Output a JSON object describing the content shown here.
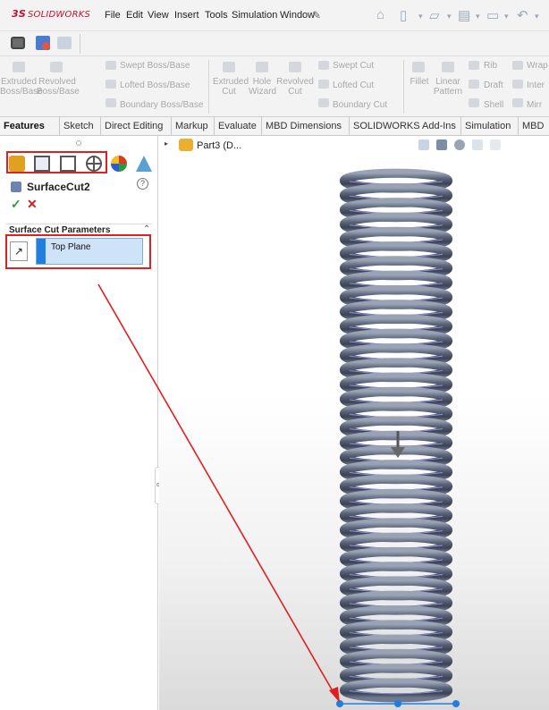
{
  "app": {
    "brand_ds": "3S",
    "brand_name": "SOLIDWORKS",
    "menu": [
      "File",
      "Edit",
      "View",
      "Insert",
      "Tools",
      "Simulation",
      "Window"
    ]
  },
  "ribbon": {
    "extruded_boss": "Extruded Boss/Base",
    "revolved_boss": "Revolved Boss/Base",
    "swept_boss": "Swept Boss/Base",
    "lofted_boss": "Lofted Boss/Base",
    "boundary_boss": "Boundary Boss/Base",
    "extruded_cut": "Extruded Cut",
    "hole_wizard": "Hole Wizard",
    "revolved_cut": "Revolved Cut",
    "swept_cut": "Swept Cut",
    "lofted_cut": "Lofted Cut",
    "boundary_cut": "Boundary Cut",
    "fillet": "Fillet",
    "linear_pattern": "Linear Pattern",
    "rib": "Rib",
    "wrap": "Wrap",
    "draft": "Draft",
    "intersect": "Inter",
    "shell": "Shell",
    "mirror": "Mirr"
  },
  "tabs": [
    "Features",
    "Sketch",
    "Direct Editing",
    "Markup",
    "Evaluate",
    "MBD Dimensions",
    "SOLIDWORKS Add-Ins",
    "Simulation",
    "MBD"
  ],
  "panel": {
    "feature_title": "SurfaceCut2",
    "section_title": "Surface Cut Parameters",
    "selection_value": "Top Plane",
    "help": "?"
  },
  "tree": {
    "part_label": "Part3 (D..."
  },
  "colors": {
    "highlight": "#e02020",
    "accent_blue": "#1e7fe0",
    "brand_red": "#c8102e"
  }
}
